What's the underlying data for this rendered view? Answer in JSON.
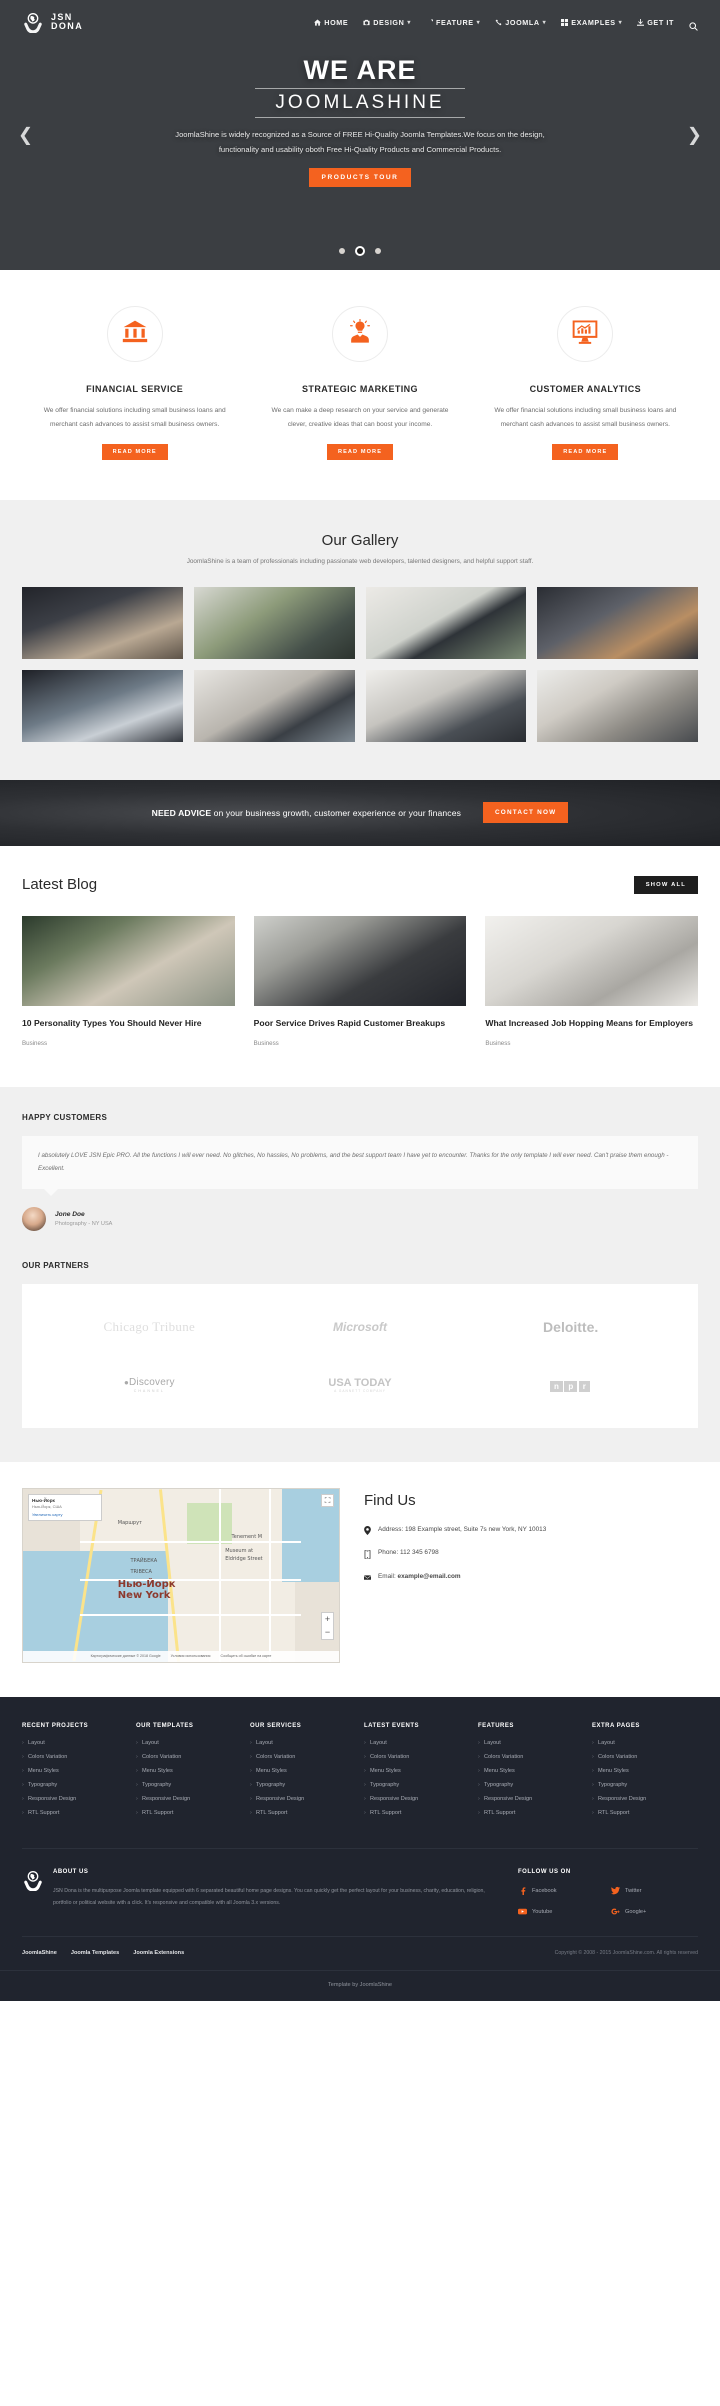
{
  "brand": {
    "line1": "JSN",
    "line2": "DONA",
    "logo_icon": "hands-globe-logo-icon"
  },
  "nav": {
    "items": [
      {
        "label": "HOME",
        "icon": "home-icon",
        "caret": false
      },
      {
        "label": "DESIGN",
        "icon": "camera-icon",
        "caret": true
      },
      {
        "label": "FEATURE",
        "icon": "pencil-icon",
        "caret": true
      },
      {
        "label": "JOOMLA",
        "icon": "joomla-icon",
        "caret": true
      },
      {
        "label": "EXAMPLES",
        "icon": "grid-icon",
        "caret": true
      },
      {
        "label": "GET IT",
        "icon": "download-icon",
        "caret": false
      }
    ],
    "search_icon": "search-icon",
    "caret_glyph": "▾"
  },
  "hero": {
    "title_top": "WE ARE",
    "title_bottom": "JOOMLASHINE",
    "subtitle": "JoomlaShine is widely recognized as a Source of FREE Hi-Quality Joomla Templates.We focus on the design, functionality and usability oboth Free Hi-Quality Products and Commercial Products.",
    "button": "PRODUCTS TOUR",
    "prev_glyph": "❮",
    "next_glyph": "❯",
    "dots": [
      false,
      true,
      false
    ]
  },
  "services": [
    {
      "icon": "bank-building-icon",
      "title": "FINANCIAL SERVICE",
      "desc": "We offer financial solutions including small business loans and merchant cash advances to assist small business owners.",
      "button": "READ MORE"
    },
    {
      "icon": "lightbulb-person-icon",
      "title": "STRATEGIC MARKETING",
      "desc": "We can make a deep research on your service and generate clever, creative ideas that can boost your income.",
      "button": "READ MORE"
    },
    {
      "icon": "monitor-chart-icon",
      "title": "CUSTOMER ANALYTICS",
      "desc": "We offer financial solutions including small business loans and merchant cash advances to assist small business owners.",
      "button": "READ MORE"
    }
  ],
  "gallery": {
    "title": "Our Gallery",
    "subtitle": "JoomlaShine is a team of professionals including passionate web developers, talented designers, and helpful support staff.",
    "items": [
      "gallery-desk-notebook",
      "gallery-woman-laptop",
      "gallery-imac-desk",
      "gallery-man-monitor",
      "gallery-window-work",
      "gallery-keyboard-desk",
      "gallery-laptop-desk",
      "gallery-coffee-notes"
    ]
  },
  "cta": {
    "strong": "NEED ADVICE",
    "rest": " on your business growth, customer experience or your finances",
    "button": "CONTACT NOW"
  },
  "blog": {
    "title": "Latest Blog",
    "show_all": "SHOW ALL",
    "posts": [
      {
        "title": "10 Personality Types You Should Never Hire",
        "category": "Business",
        "image": "blog-two-men-talking"
      },
      {
        "title": "Poor Service Drives Rapid Customer Breakups",
        "category": "Business",
        "image": "blog-laptop-dark-room"
      },
      {
        "title": "What Increased Job Hopping Means for Employers",
        "category": "Business",
        "image": "blog-notebook-mug"
      }
    ]
  },
  "testimonial": {
    "heading": "HAPPY CUSTOMERS",
    "quote": "I absolutely LOVE JSN Epic PRO. All the functions I will ever need. No glitches, No hassles, No problems, and the best support team I have yet to encounter. Thanks for the only template I will ever need. Can't praise them enough - Excellent.",
    "author_name": "Jone Doe",
    "author_role": "Photography - NY USA",
    "avatar": "customer-avatar"
  },
  "partners": {
    "heading": "OUR PARTNERS",
    "logos": [
      {
        "name": "Chicago Tribune",
        "key": "chicago-tribune-logo"
      },
      {
        "name": "Microsoft",
        "key": "microsoft-logo"
      },
      {
        "name": "Deloitte.",
        "key": "deloitte-logo"
      },
      {
        "name": "Discovery",
        "key": "discovery-channel-logo",
        "sub": "CHANNEL"
      },
      {
        "name": "USA TODAY",
        "key": "usa-today-logo",
        "sub": "A GANNETT COMPANY"
      },
      {
        "name": "npr",
        "key": "npr-logo"
      }
    ]
  },
  "findus": {
    "title": "Find Us",
    "address": "Address: 198 Example street, Suite 7s new York, NY 10013",
    "phone": "Phone: 112 345 6798",
    "email_label": "Email:",
    "email_value": "example@email.com",
    "map": {
      "search_title": "Нью-Йорк",
      "search_sub": "Нью-Йорк, США",
      "search_link": "Увеличить карту",
      "city_l1": "Нью-Йорк",
      "city_l2": "New York",
      "labels": [
        "ТРАЙБЕКА",
        "TRIBECA",
        "Tenement M",
        "Museum at",
        "Eldridge Street",
        "Маршрут"
      ],
      "controls": {
        "fullscreen": "⛶",
        "zoom_in": "+",
        "zoom_out": "−"
      },
      "footer": [
        "Картографические данные © 2018 Google",
        "Условия использования",
        "Сообщить об ошибке на карте"
      ]
    }
  },
  "footer": {
    "columns": [
      {
        "heading": "RECENT PROJECTS",
        "items": [
          "Layout",
          "Colors Variation",
          "Menu Styles",
          "Typography",
          "Responsive Design",
          "RTL Support"
        ]
      },
      {
        "heading": "OUR TEMPLATES",
        "items": [
          "Layout",
          "Colors Variation",
          "Menu Styles",
          "Typography",
          "Responsive Design",
          "RTL Support"
        ]
      },
      {
        "heading": "OUR SERVICES",
        "items": [
          "Layout",
          "Colors Variation",
          "Menu Styles",
          "Typography",
          "Responsive Design",
          "RTL Support"
        ]
      },
      {
        "heading": "LATEST EVENTS",
        "items": [
          "Layout",
          "Colors Variation",
          "Menu Styles",
          "Typography",
          "Responsive Design",
          "RTL Support"
        ]
      },
      {
        "heading": "FEATURES",
        "items": [
          "Layout",
          "Colors Variation",
          "Menu Styles",
          "Typography",
          "Responsive Design",
          "RTL Support"
        ]
      },
      {
        "heading": "EXTRA PAGES",
        "items": [
          "Layout",
          "Colors Variation",
          "Menu Styles",
          "Typography",
          "Responsive Design",
          "RTL Support"
        ]
      }
    ],
    "about": {
      "heading": "ABOUT US",
      "text": "JSN Dona is the multipurpose Joomla template equipped with 6 separated beautiful home page designs. You can quickly get the perfect layout for your business, charity, education, religion, portfolio or political website with a click. It's responsive and compatible with all Joomla 3.x versions.",
      "logo_icon": "hands-globe-logo-icon"
    },
    "follow": {
      "heading": "FOLLOW US ON",
      "socials": [
        {
          "label": "Facebook",
          "icon": "facebook-icon",
          "color": "#f4621f"
        },
        {
          "label": "Twitter",
          "icon": "twitter-icon",
          "color": "#f4621f"
        },
        {
          "label": "Youtube",
          "icon": "youtube-icon",
          "color": "#f4621f"
        },
        {
          "label": "Google+",
          "icon": "google-plus-icon",
          "color": "#f4621f"
        }
      ]
    },
    "bottom_links": [
      "JoomlaShine",
      "Joomla Templates",
      "Joomla Extensions"
    ],
    "copyright": "Copyright © 2008 - 2015 JoomlaShine.com. All rights reserved",
    "template_by": "Template by JoomlaShine"
  },
  "colors": {
    "accent": "#f4621f",
    "footer_bg": "#20242e",
    "dark": "#1e1e1e",
    "section_gray": "#f0f0f0"
  }
}
